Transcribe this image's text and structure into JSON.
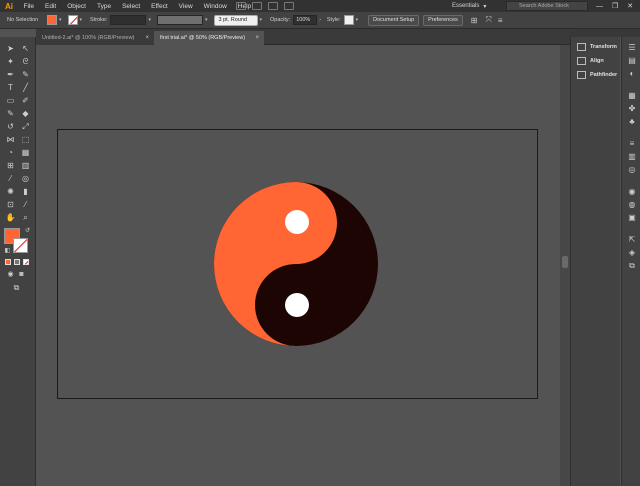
{
  "app": {
    "logo": "Ai"
  },
  "menu": [
    "File",
    "Edit",
    "Object",
    "Type",
    "Select",
    "Effect",
    "View",
    "Window",
    "Help"
  ],
  "workspace": {
    "label": "Essentials",
    "search_placeholder": "Search Adobe Stock"
  },
  "window_controls": {
    "minimize": "—",
    "restore": "❐",
    "close": "✕"
  },
  "controlbar": {
    "selection": "No Selection",
    "fill_color": "#ff6633",
    "stroke_label": "Stroke:",
    "brush": "3 pt. Round",
    "opacity_label": "Opacity:",
    "opacity_value": "100%",
    "style_label": "Style:",
    "document_setup": "Document Setup",
    "preferences": "Preferences"
  },
  "tabs": [
    {
      "label": "Untitled-2.ai* @ 100% (RGB/Preview)",
      "active": false,
      "close": "×"
    },
    {
      "label": "first trial.ai* @ 50% (RGB/Preview)",
      "active": true,
      "close": "×"
    }
  ],
  "panels": [
    {
      "label": "Transform"
    },
    {
      "label": "Align"
    },
    {
      "label": "Pathfinder"
    }
  ],
  "artwork": {
    "color_light": "#ff6633",
    "color_dark": "#1c0503",
    "dot": "#ffffff"
  },
  "toolbar": {
    "fill_color": "#ff6633",
    "stroke_color": "#ffffff"
  }
}
